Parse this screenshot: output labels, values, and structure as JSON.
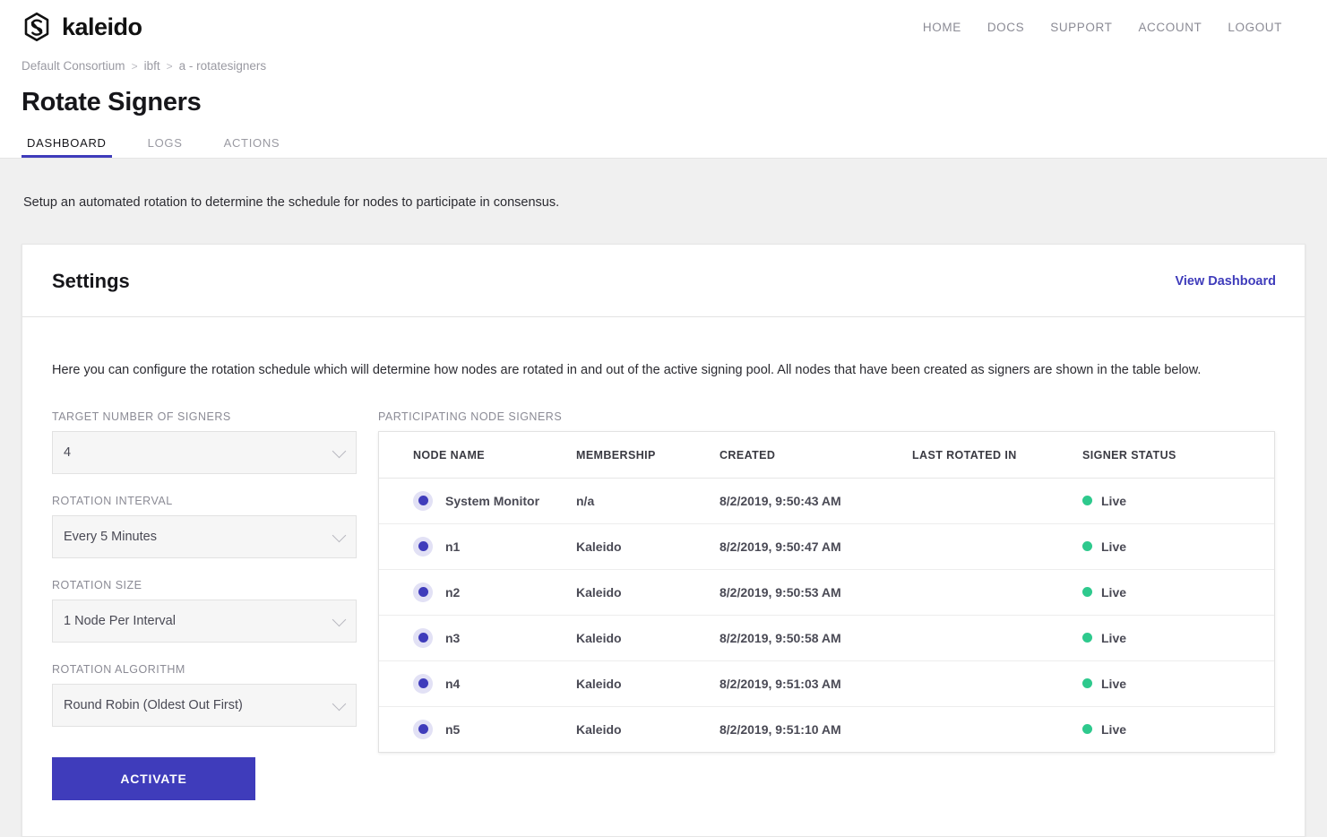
{
  "brand": {
    "name": "kaleido",
    "logo_icon": "kaleido-hex-logo"
  },
  "topnav": [
    {
      "label": "HOME"
    },
    {
      "label": "DOCS"
    },
    {
      "label": "SUPPORT"
    },
    {
      "label": "ACCOUNT"
    },
    {
      "label": "LOGOUT"
    }
  ],
  "breadcrumb": {
    "items": [
      {
        "label": "Default Consortium"
      },
      {
        "label": "ibft"
      },
      {
        "label": "a - rotatesigners"
      }
    ],
    "separator": ">"
  },
  "page_title": "Rotate Signers",
  "tabs": [
    {
      "label": "DASHBOARD",
      "active": true
    },
    {
      "label": "LOGS",
      "active": false
    },
    {
      "label": "ACTIONS",
      "active": false
    }
  ],
  "intro": "Setup an automated rotation to determine the schedule for nodes to participate in consensus.",
  "settings_card": {
    "title": "Settings",
    "view_dashboard_label": "View Dashboard",
    "description": "Here you can configure the rotation schedule which will determine how nodes are rotated in and out of the active signing pool. All nodes that have been created as signers are shown in the table below.",
    "fields": [
      {
        "label": "TARGET NUMBER OF SIGNERS",
        "value": "4",
        "icon": "chevron-down-icon"
      },
      {
        "label": "ROTATION INTERVAL",
        "value": "Every 5 Minutes",
        "icon": "chevron-down-icon"
      },
      {
        "label": "ROTATION SIZE",
        "value": "1 Node Per Interval",
        "icon": "chevron-down-icon"
      },
      {
        "label": "ROTATION ALGORITHM",
        "value": "Round Robin (Oldest Out First)",
        "icon": "chevron-down-icon"
      }
    ],
    "activate_label": "ACTIVATE"
  },
  "table": {
    "caption": "PARTICIPATING NODE SIGNERS",
    "columns": [
      "NODE NAME",
      "MEMBERSHIP",
      "CREATED",
      "LAST ROTATED IN",
      "SIGNER STATUS"
    ],
    "rows": [
      {
        "node_name": "System Monitor",
        "membership": "n/a",
        "created": "8/2/2019, 9:50:43 AM",
        "last_rotated_in": "",
        "status": "Live"
      },
      {
        "node_name": "n1",
        "membership": "Kaleido",
        "created": "8/2/2019, 9:50:47 AM",
        "last_rotated_in": "",
        "status": "Live"
      },
      {
        "node_name": "n2",
        "membership": "Kaleido",
        "created": "8/2/2019, 9:50:53 AM",
        "last_rotated_in": "",
        "status": "Live"
      },
      {
        "node_name": "n3",
        "membership": "Kaleido",
        "created": "8/2/2019, 9:50:58 AM",
        "last_rotated_in": "",
        "status": "Live"
      },
      {
        "node_name": "n4",
        "membership": "Kaleido",
        "created": "8/2/2019, 9:51:03 AM",
        "last_rotated_in": "",
        "status": "Live"
      },
      {
        "node_name": "n5",
        "membership": "Kaleido",
        "created": "8/2/2019, 9:51:10 AM",
        "last_rotated_in": "",
        "status": "Live"
      }
    ]
  },
  "colors": {
    "accent": "#3f3cbb",
    "status_live": "#2ec98d",
    "node_dot": "#3f3cbb",
    "node_dot_halo": "#e2e1f5",
    "page_bg": "#f0f0f0",
    "muted_text": "#8b8b95"
  }
}
